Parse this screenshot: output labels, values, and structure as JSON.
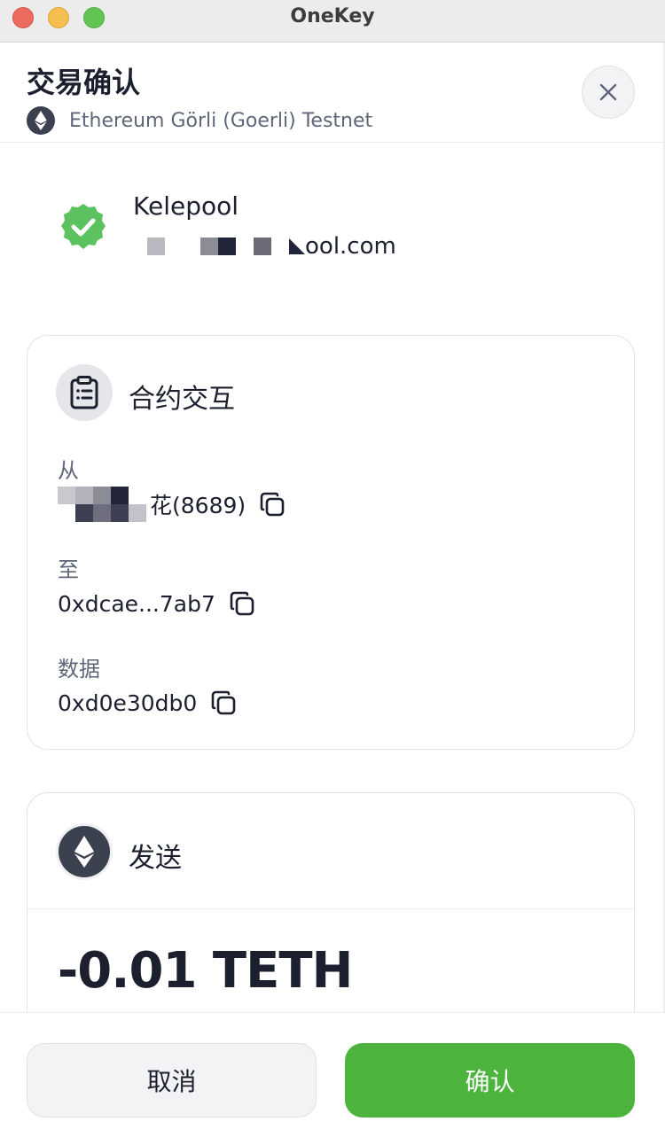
{
  "window": {
    "title": "OneKey"
  },
  "header": {
    "title": "交易确认",
    "network": "Ethereum Görli (Goerli) Testnet",
    "network_icon": "ethereum-icon",
    "close_icon": "close-icon"
  },
  "dapp": {
    "name": "Kelepool",
    "url_visible": "ool.com",
    "verified_icon": "check-circle-icon",
    "verified_color": "#5cc15f"
  },
  "contract": {
    "title": "合约交互",
    "icon": "clipboard-icon",
    "from_label": "从",
    "from_value": "花(8689)",
    "to_label": "至",
    "to_value": "0xdcae...7ab7",
    "data_label": "数据",
    "data_value": "0xd0e30db0",
    "copy_icon": "copy-icon"
  },
  "send": {
    "title": "发送",
    "icon": "ethereum-icon",
    "amount": "-0.01 TETH"
  },
  "footer": {
    "cancel_label": "取消",
    "confirm_label": "确认",
    "confirm_color": "#4cb43c"
  }
}
